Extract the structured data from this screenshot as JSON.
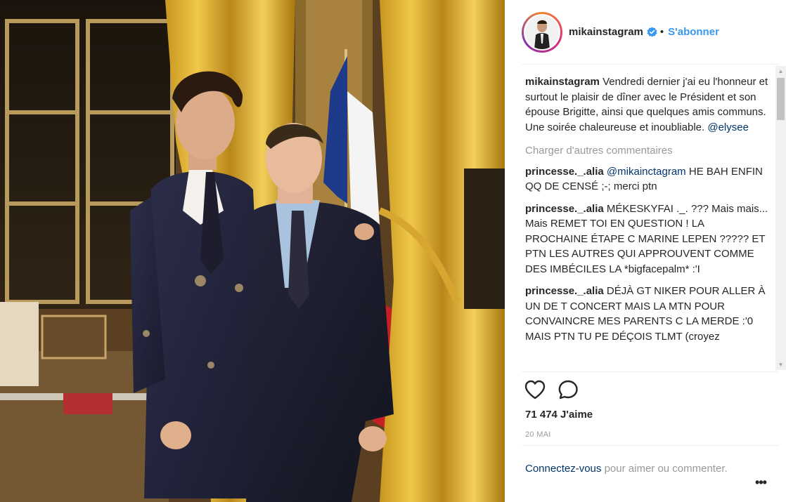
{
  "post": {
    "author": "mikainstagram",
    "follow_label": "S'abonner",
    "separator": "•",
    "verified_icon": "verified-badge-icon",
    "caption": "Vendredi dernier j'ai eu l'honneur et surtout le plaisir de dîner avec le Président et son épouse Brigitte, ainsi que quelques amis communs. Une soirée chaleureuse et inoubliable.",
    "caption_mention": "@elysee",
    "load_more": "Charger d'autres commentaires",
    "comments": [
      {
        "user": "princesse._.alia",
        "mention": "@mikainctagram",
        "text": "HE BAH ENFIN QQ DE CENSÉ ;-; merci ptn"
      },
      {
        "user": "princesse._.alia",
        "text": "MÉKESKYFAI ._. ??? Mais mais... Mais REMET TOI EN QUESTION ! LA PROCHAINE ÉTAPE C MARINE LEPEN ????? ET PTN LES AUTRES QUI APPROUVENT COMME DES IMBÉCILES LA *bigfacepalm* :'I"
      },
      {
        "user": "princesse._.alia",
        "text": "DÉJÀ GT NIKER POUR ALLER À UN DE T CONCERT MAIS LA MTN POUR CONVAINCRE MES PARENTS C LA MERDE :'0 MAIS PTN TU PE DÉÇOIS TLMT (croyez"
      }
    ],
    "likes": "71 474 J'aime",
    "date": "20 MAI",
    "login_link": "Connectez-vous",
    "login_text": "pour aimer ou commenter.",
    "more_label": "•••",
    "icons": {
      "like": "heart-icon",
      "comment": "comment-bubble-icon",
      "scroll_up": "scroll-up-arrow-icon",
      "scroll_down": "scroll-down-arrow-icon"
    },
    "colors": {
      "link": "#3897f0",
      "mention": "#003569",
      "muted": "#999999",
      "text": "#262626"
    }
  }
}
